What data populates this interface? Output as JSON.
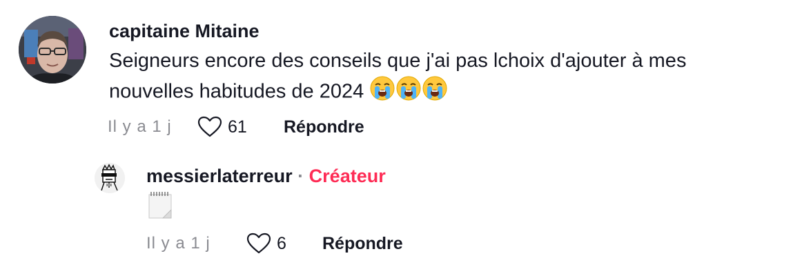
{
  "comment": {
    "username": "capitaine Mitaine",
    "text": "Seigneurs encore des conseils que j'ai pas lchoix d'ajouter à mes nouvelles habitudes de 2024",
    "emojis": [
      "😭",
      "😭",
      "😭"
    ],
    "timestamp": "Il y a 1 j",
    "like_count": "61",
    "reply_label": "Répondre"
  },
  "reply": {
    "username": "messierlaterreur",
    "separator": "·",
    "badge": "Créateur",
    "text_icon": "notepad-icon",
    "timestamp": "Il y a 1 j",
    "like_count": "6",
    "reply_label": "Répondre"
  },
  "colors": {
    "text": "#161823",
    "muted": "#8a8b91",
    "creator_badge": "#fe2c55"
  }
}
